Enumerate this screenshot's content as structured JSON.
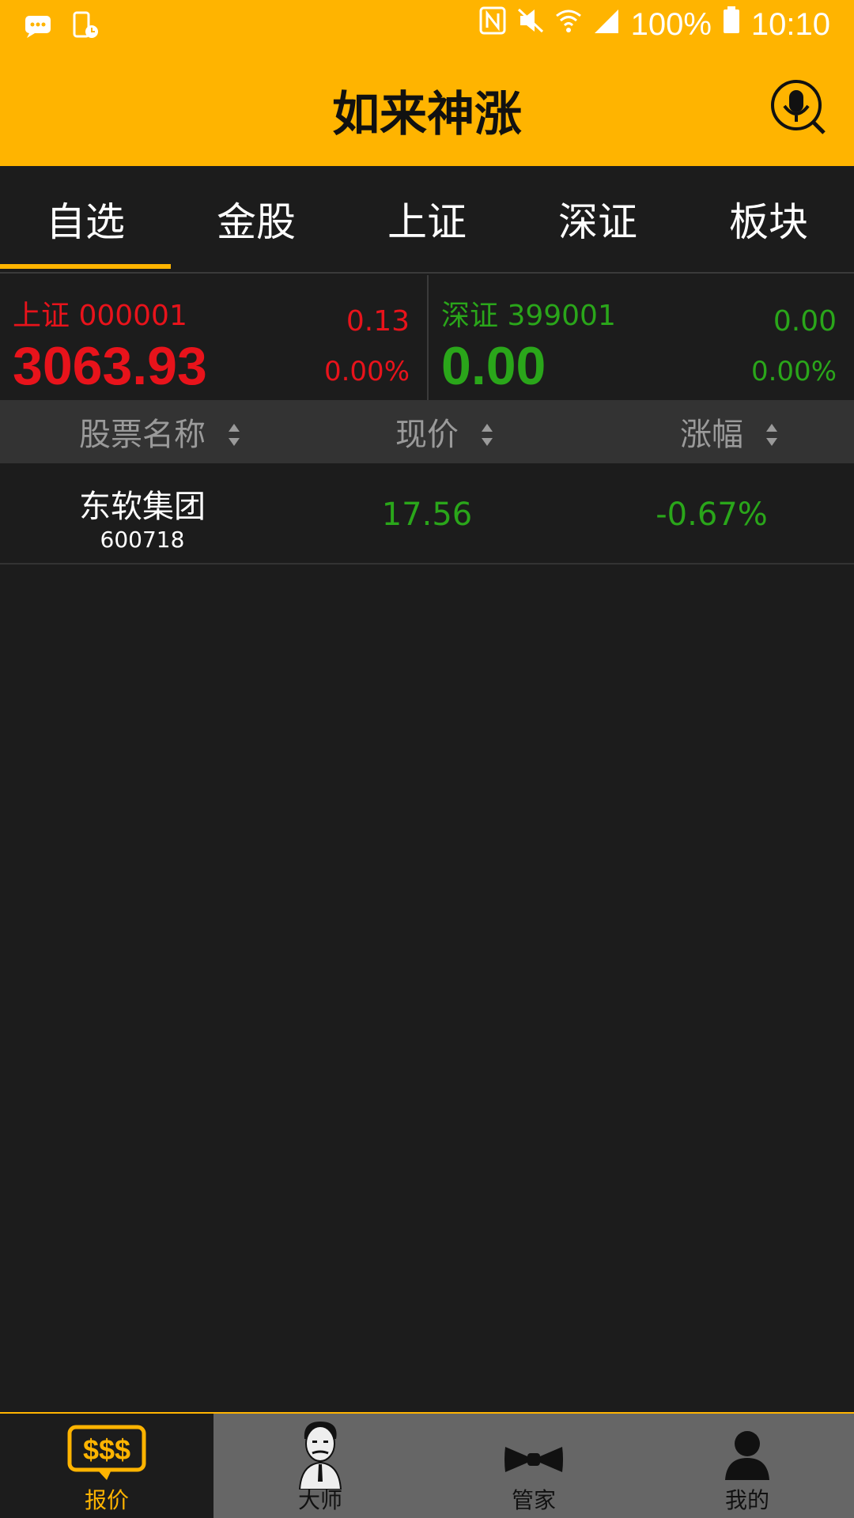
{
  "status_bar": {
    "battery": "100%",
    "time": "10:10",
    "icons": [
      "message-icon",
      "phone-schedule-icon",
      "nfc-icon",
      "mute-icon",
      "wifi-icon",
      "signal-icon",
      "battery-icon"
    ]
  },
  "header": {
    "title": "如来神涨",
    "voice_search_icon": "voice-search-icon",
    "accent_color": "#ffb400"
  },
  "tabs": [
    {
      "label": "自选",
      "active": true
    },
    {
      "label": "金股",
      "active": false
    },
    {
      "label": "上证",
      "active": false
    },
    {
      "label": "深证",
      "active": false
    },
    {
      "label": "板块",
      "active": false
    }
  ],
  "indices": {
    "shanghai": {
      "name": "上证 000001",
      "change": "0.13",
      "value": "3063.93",
      "pct": "0.00%",
      "color": "#e8131b"
    },
    "shenzhen": {
      "name": "深证 399001",
      "change": "0.00",
      "value": "0.00",
      "pct": "0.00%",
      "color": "#2aa61a"
    }
  },
  "table": {
    "columns": [
      "股票名称",
      "现价",
      "涨幅"
    ],
    "rows": [
      {
        "name": "东软集团",
        "code": "600718",
        "price": "17.56",
        "pct": "-0.67%"
      }
    ]
  },
  "bottom_nav": [
    {
      "label": "报价",
      "icon": "dollar-quote-icon",
      "active": true
    },
    {
      "label": "大师",
      "icon": "master-face-icon",
      "active": false
    },
    {
      "label": "管家",
      "icon": "bowtie-icon",
      "active": false
    },
    {
      "label": "我的",
      "icon": "user-icon",
      "active": false
    }
  ]
}
